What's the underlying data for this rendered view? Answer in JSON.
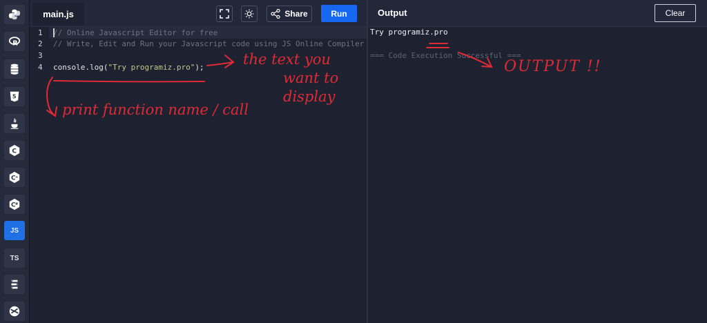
{
  "sidebar": {
    "items": [
      {
        "icon": "python-icon"
      },
      {
        "icon": "r-lang-icon"
      },
      {
        "icon": "database-icon"
      },
      {
        "icon": "html5-icon"
      },
      {
        "icon": "java-icon"
      },
      {
        "icon": "c-lang-icon"
      },
      {
        "icon": "cpp-icon"
      },
      {
        "icon": "csharp-icon"
      },
      {
        "icon": "javascript-icon",
        "label": "JS",
        "active": true
      },
      {
        "icon": "typescript-icon",
        "label": "TS"
      },
      {
        "icon": "swift-icon"
      },
      {
        "icon": "go-icon"
      }
    ]
  },
  "editor": {
    "tab_label": "main.js",
    "share_label": "Share",
    "run_label": "Run",
    "lines": [
      {
        "num": "1",
        "text": "// Online Javascript Editor for free"
      },
      {
        "num": "2",
        "text": "// Write, Edit and Run your Javascript code using JS Online Compiler"
      },
      {
        "num": "3",
        "text": ""
      },
      {
        "num": "4",
        "code_prefix": "console.log(",
        "code_string": "\"Try programiz.pro\"",
        "code_suffix": ");"
      }
    ]
  },
  "output": {
    "title": "Output",
    "clear_label": "Clear",
    "lines": [
      "Try programiz.pro",
      "=== Code Execution Successful ==="
    ]
  },
  "annotations": {
    "text_note_1": "the text you",
    "text_note_2": "want to",
    "text_note_3": "display",
    "output_note": "OUTPUT !!",
    "print_note": "print function name / call"
  },
  "colors": {
    "accent": "#1668f2",
    "annotation": "#e02a35",
    "background": "#1d2130"
  }
}
